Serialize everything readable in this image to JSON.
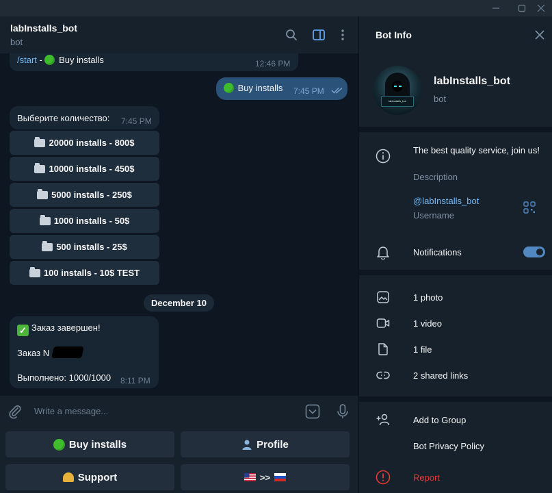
{
  "window": {
    "controls": [
      "minimize-icon",
      "maximize-icon",
      "close-icon"
    ]
  },
  "chat_header": {
    "title": "labInstalls_bot",
    "subtitle": "bot",
    "icons": [
      "search-icon",
      "sidebar-toggle-icon",
      "more-vertical-icon"
    ]
  },
  "messages": {
    "m1": {
      "command": "/start",
      "separator": " - ",
      "text": "Buy installs",
      "time": "12:46 PM"
    },
    "m2": {
      "text": "Buy installs",
      "time": "7:45 PM"
    },
    "m3": {
      "text": "Выберите количество:",
      "time": "7:45 PM",
      "buttons": [
        "20000 installs - 800$",
        "10000 installs - 450$",
        "5000 installs - 250$",
        "1000 installs - 50$",
        "500 installs - 25$",
        "100 installs - 10$ TEST"
      ]
    },
    "date_separator": "December 10",
    "m4": {
      "line1": "Заказ завершен!",
      "line2": "Заказ N",
      "line3": "Выполнено: 1000/1000",
      "time": "8:11 PM"
    }
  },
  "composer": {
    "placeholder": "Write a message...",
    "icons": [
      "attach-icon",
      "bot-commands-icon",
      "microphone-icon"
    ]
  },
  "reply_keyboard": {
    "buy": "Buy installs",
    "profile": "Profile",
    "support": "Support",
    "language": ">>"
  },
  "info_panel": {
    "title": "Bot Info",
    "name": "labInstalls_bot",
    "subtitle": "bot",
    "avatar_text": "labInstalls_bot",
    "description": "The best quality service, join us!",
    "description_label": "Description",
    "username": "@labInstalls_bot",
    "username_label": "Username",
    "notifications": "Notifications",
    "notifications_on": true,
    "media": {
      "photo": "1 photo",
      "video": "1 video",
      "file": "1 file",
      "links": "2 shared links"
    },
    "actions": {
      "add_to_group": "Add to Group",
      "privacy": "Bot Privacy Policy",
      "report": "Report"
    }
  },
  "colors": {
    "background": "#0e1621",
    "panel": "#17212b",
    "outgoing": "#2b5278",
    "incoming": "#182533",
    "accent": "#5288c1",
    "link": "#71baf9",
    "report": "#e53935"
  }
}
